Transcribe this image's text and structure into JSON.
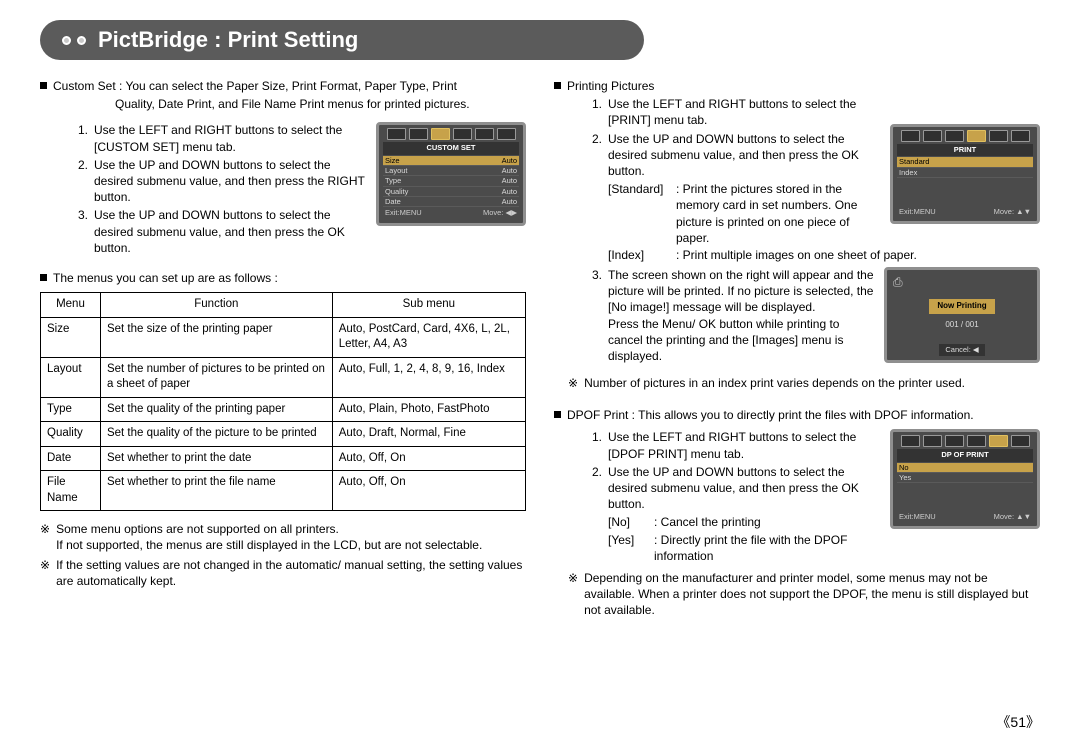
{
  "page_title": "PictBridge : Print Setting",
  "left": {
    "custom_set_heading": "Custom Set : You can select the Paper Size, Print Format, Paper Type, Print",
    "custom_set_heading2": "Quality, Date Print, and File Name Print menus for printed pictures.",
    "steps": [
      {
        "num": "1.",
        "text": "Use the LEFT and RIGHT buttons to select the [CUSTOM SET] menu tab."
      },
      {
        "num": "2.",
        "text": "Use the UP and DOWN buttons to select the desired submenu value, and then press the RIGHT button."
      },
      {
        "num": "3.",
        "text": "Use the UP and DOWN buttons to select the desired submenu value, and then press the OK button."
      }
    ],
    "lcd_customset": {
      "header": "CUSTOM SET",
      "rows": [
        {
          "left": "Size",
          "right": "Auto"
        },
        {
          "left": "Layout",
          "right": "Auto"
        },
        {
          "left": "Type",
          "right": "Auto"
        },
        {
          "left": "Quality",
          "right": "Auto"
        },
        {
          "left": "Date",
          "right": "Auto"
        }
      ],
      "foot_left": "Exit:MENU",
      "foot_right": "Move: ◀▶"
    },
    "menus_heading": "The menus you can set up are as follows :",
    "table_headers": {
      "menu": "Menu",
      "function": "Function",
      "submenu": "Sub menu"
    },
    "table_rows": [
      {
        "menu": "Size",
        "function": "Set the size of the printing paper",
        "submenu": "Auto, PostCard, Card, 4X6, L, 2L, Letter, A4, A3"
      },
      {
        "menu": "Layout",
        "function": "Set the number of pictures to be printed on a sheet of paper",
        "submenu": "Auto, Full, 1, 2, 4, 8, 9, 16, Index"
      },
      {
        "menu": "Type",
        "function": "Set the quality of the printing paper",
        "submenu": "Auto, Plain, Photo, FastPhoto"
      },
      {
        "menu": "Quality",
        "function": "Set the quality of the picture to be printed",
        "submenu": "Auto, Draft, Normal, Fine"
      },
      {
        "menu": "Date",
        "function": "Set whether to print the date",
        "submenu": "Auto, Off, On"
      },
      {
        "menu": "File Name",
        "function": "Set whether to print the file name",
        "submenu": "Auto, Off, On"
      }
    ],
    "notes": [
      "Some menu options are not supported on all printers.\nIf not supported, the menus are still displayed in the LCD, but are not selectable.",
      "If the setting values are not changed in the automatic/ manual setting, the setting values are automatically kept."
    ],
    "note_symbol": "※"
  },
  "right": {
    "printing_heading": "Printing Pictures",
    "printing_steps": [
      {
        "num": "1.",
        "text": "Use the LEFT and RIGHT buttons to select the [PRINT] menu tab."
      },
      {
        "num": "2.",
        "text": "Use the UP and DOWN buttons to select the desired submenu value, and then press the OK button."
      }
    ],
    "print_defs": [
      {
        "label": "[Standard]",
        "text": ": Print the pictures stored in the memory card in set numbers. One picture is printed on one piece of paper."
      },
      {
        "label": "[Index]",
        "text": ": Print multiple images on one sheet of paper."
      }
    ],
    "printing_step3": {
      "num": "3.",
      "text": "The screen shown on the right will appear and the picture will be printed. If no picture is selected, the [No image!] message will be displayed.\nPress the Menu/ OK button while printing to cancel the printing and the [Images] menu is displayed."
    },
    "lcd_print": {
      "header": "PRINT",
      "rows": [
        {
          "left": "Standard",
          "right": ""
        },
        {
          "left": "Index",
          "right": ""
        }
      ],
      "foot_left": "Exit:MENU",
      "foot_right": "Move: ▲▼"
    },
    "lcd_nowprinting": {
      "label": "Now Printing",
      "count": "001 / 001",
      "cancel": "Cancel: ◀"
    },
    "index_note": "Number of pictures in an index print varies depends on the printer used.",
    "dpof_heading": "DPOF Print : This allows you to directly print the files with DPOF information.",
    "dpof_steps": [
      {
        "num": "1.",
        "text": "Use the LEFT and RIGHT buttons to select the [DPOF PRINT] menu tab."
      },
      {
        "num": "2.",
        "text": "Use the UP and DOWN buttons to select the desired submenu value, and then press the OK button."
      }
    ],
    "dpof_defs": [
      {
        "label": "[No]",
        "text": ": Cancel the printing"
      },
      {
        "label": "[Yes]",
        "text": ": Directly print the file with the DPOF information"
      }
    ],
    "lcd_dpof": {
      "header": "DP OF PRINT",
      "rows": [
        {
          "left": "No",
          "right": ""
        },
        {
          "left": "Yes",
          "right": ""
        }
      ],
      "foot_left": "Exit:MENU",
      "foot_right": "Move: ▲▼"
    },
    "dpof_note": "Depending on the manufacturer and printer model, some menus may not be available. When a printer does not support the DPOF, the menu is still displayed but not available."
  },
  "page_number": "《51》"
}
